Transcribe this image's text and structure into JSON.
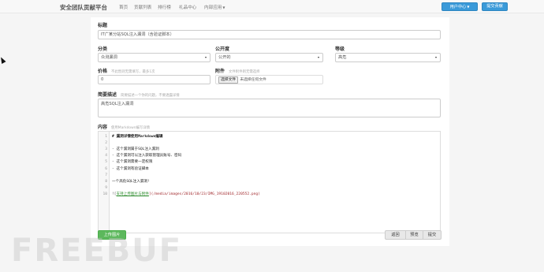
{
  "nav": {
    "brand": "安全团队贡献平台",
    "links": [
      "首页",
      "贡献列表",
      "排行榜",
      "礼品中心",
      "内部应用"
    ],
    "user_center": "用户中心",
    "submit": "提交贡献"
  },
  "form": {
    "title": {
      "label": "标题",
      "value": "IT广某分站SQL注入漏洞（含验证脚本）"
    },
    "category": {
      "label": "分类",
      "value": "众测漏洞"
    },
    "visibility": {
      "label": "公开度",
      "value": "公开的"
    },
    "level": {
      "label": "等级",
      "value": "高危"
    },
    "price": {
      "label": "价格",
      "hint": "不此售则无需填写，最多1次",
      "value": "0"
    },
    "attachment": {
      "label": "附件",
      "hint": "文件附件则无需选择",
      "button": "选择文件",
      "status": "未选择任何文件"
    },
    "summary": {
      "label": "简要描述",
      "hint": "简要描述一个你的问题，不要透露详情",
      "value": "高危SQL注入漏洞"
    },
    "content": {
      "label": "内容",
      "hint": "使用Markdown编写详情"
    }
  },
  "editor": {
    "lines": [
      {
        "num": "1",
        "parts": [
          {
            "t": "# 漏洞详情使用",
            "c": "b"
          },
          {
            "t": "Markdown",
            "c": "b"
          },
          {
            "t": "编辑",
            "c": "b"
          }
        ]
      },
      {
        "num": "2",
        "parts": []
      },
      {
        "num": "3",
        "parts": [
          {
            "t": "- 这个漏洞属于SQL注入漏洞",
            "c": ""
          }
        ]
      },
      {
        "num": "4",
        "parts": [
          {
            "t": "- 这个漏洞可以注入获取管理员账号、密码",
            "c": ""
          }
        ]
      },
      {
        "num": "5",
        "parts": [
          {
            "t": "- 这个漏洞需要一定权限",
            "c": ""
          }
        ]
      },
      {
        "num": "6",
        "parts": [
          {
            "t": "- 这个漏洞有验证脚本",
            "c": ""
          }
        ]
      },
      {
        "num": "7",
        "parts": []
      },
      {
        "num": "8",
        "parts": [
          {
            "t": "一个高危SQL注入漏洞!",
            "c": ""
          }
        ]
      },
      {
        "num": "9",
        "parts": []
      },
      {
        "num": "10",
        "parts": [
          {
            "t": "![",
            "c": "bracket"
          },
          {
            "t": "支持上传图片与附件",
            "c": "link"
          },
          {
            "t": "](/media/images/2016/10/23/IMG_19102016_220552.png)",
            "c": "url"
          }
        ]
      }
    ]
  },
  "actions": {
    "upload": "上传图片",
    "back": "返回",
    "preview": "预览",
    "submit": "提交"
  },
  "watermark": "FREEBUF"
}
